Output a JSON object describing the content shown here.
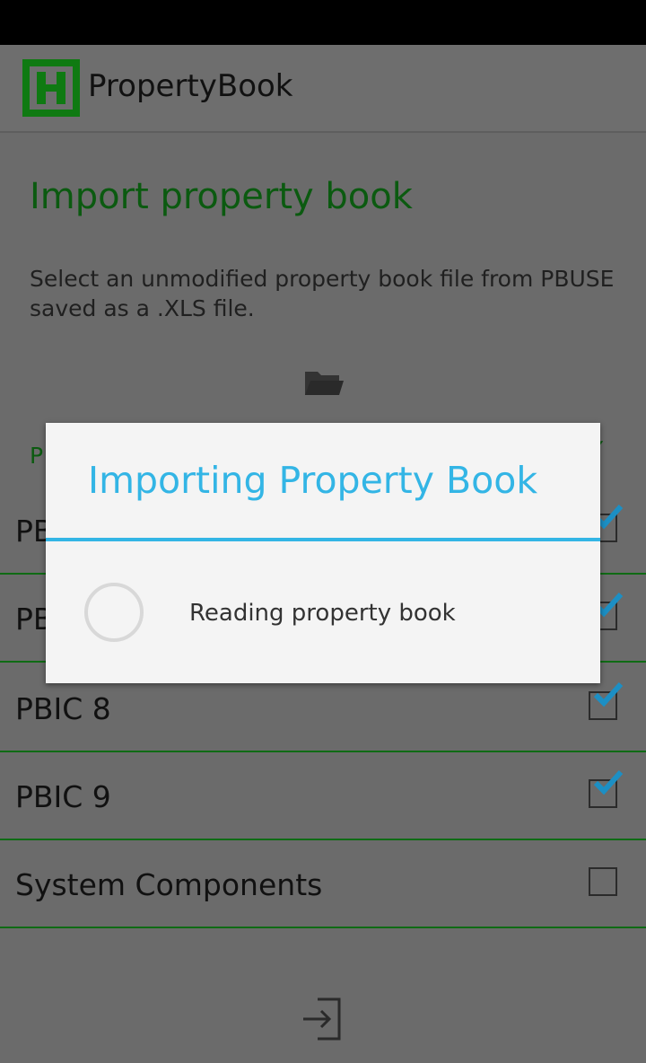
{
  "app": {
    "title": "PropertyBook",
    "logo_letter": "H"
  },
  "page": {
    "title": "Import property book",
    "instructions": "Select an unmodified property book file from PBUSE saved as a .XLS file."
  },
  "list": {
    "header_label": "P",
    "rows": [
      {
        "label": "PB",
        "checked": true
      },
      {
        "label": "PB",
        "checked": true
      },
      {
        "label": "PBIC 8",
        "checked": true
      },
      {
        "label": "PBIC 9",
        "checked": true
      },
      {
        "label": "System Components",
        "checked": false
      }
    ]
  },
  "dialog": {
    "title": "Importing Property Book",
    "message": "Reading property book"
  },
  "icons": {
    "folder": "folder-open-icon",
    "import": "import-icon",
    "check": "checkmark-icon"
  },
  "colors": {
    "accent_blue": "#33b5e5",
    "brand_green": "#0f7a12",
    "text_green": "#0b5a10"
  }
}
